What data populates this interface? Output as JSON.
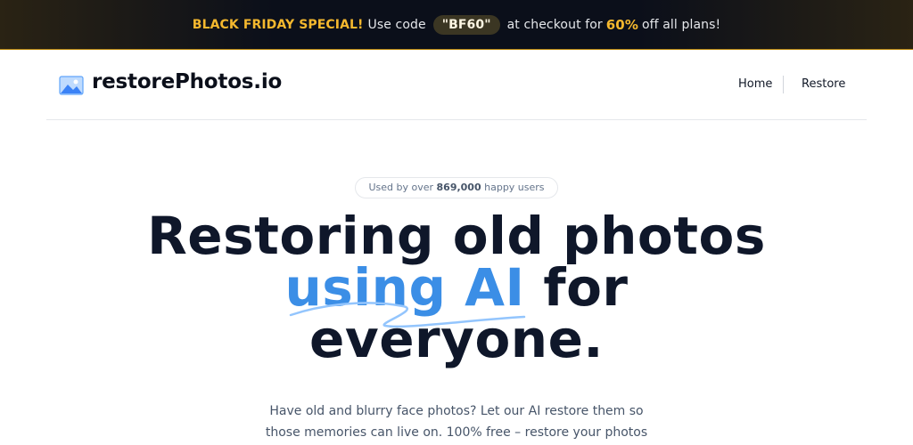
{
  "promo": {
    "label": "BLACK FRIDAY SPECIAL!",
    "text_before": "Use code",
    "code": "\"BF60\"",
    "text_middle": "at checkout for",
    "discount": "60%",
    "text_after": "off all plans!"
  },
  "header": {
    "brand": "restorePhotos.io",
    "logo_icon": "image-icon",
    "nav": {
      "home": "Home",
      "restore": "Restore"
    }
  },
  "hero": {
    "users_prefix": "Used by over",
    "users_count": "869,000",
    "users_suffix": "happy users",
    "title_line1": "Restoring old photos",
    "title_highlight": "using AI",
    "title_line2_rest": " for",
    "title_line3": "everyone.",
    "description_line1": "Have old and blurry face photos? Let our AI restore them so",
    "description_line2": "those memories can live on. 100% free – restore your photos"
  },
  "colors": {
    "accent_blue": "#3b8ee6",
    "promo_gold": "#f5b82e",
    "dark": "#0f172a"
  }
}
